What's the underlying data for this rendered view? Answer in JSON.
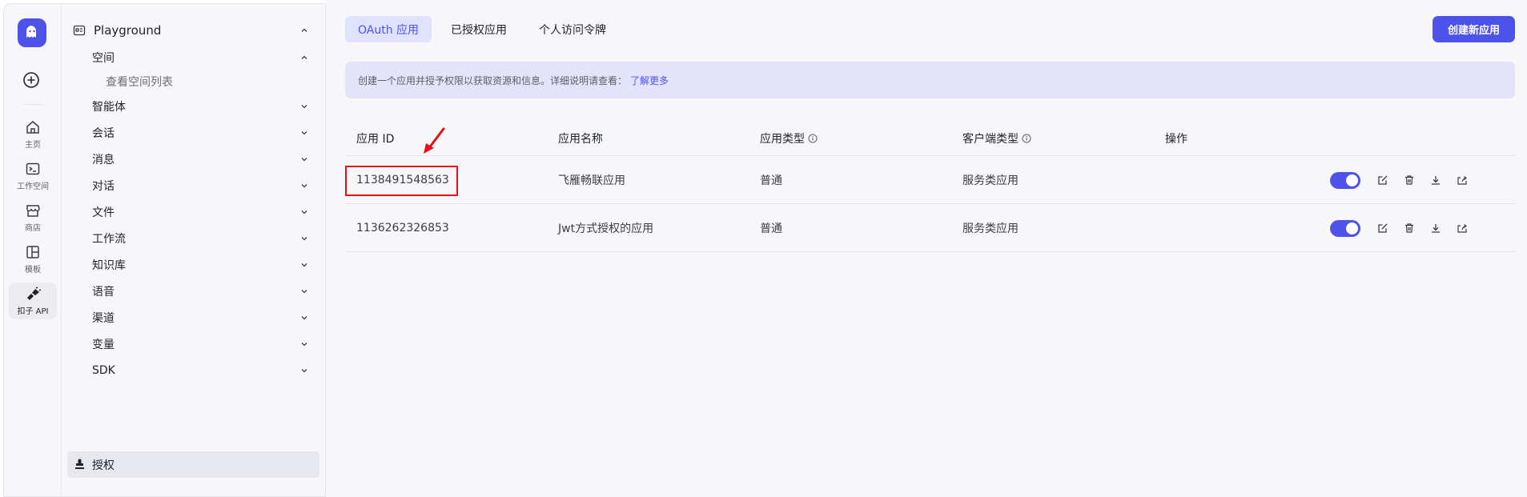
{
  "rail": {
    "items": [
      {
        "label": "主页",
        "icon": "home-icon"
      },
      {
        "label": "工作空间",
        "icon": "terminal-icon"
      },
      {
        "label": "商店",
        "icon": "store-icon"
      },
      {
        "label": "模板",
        "icon": "template-icon"
      },
      {
        "label": "扣子 API",
        "icon": "api-icon"
      }
    ]
  },
  "nav": {
    "playground": "Playground",
    "space": "空间",
    "space_sub": "查看空间列表",
    "items": [
      "智能体",
      "会话",
      "消息",
      "对话",
      "文件",
      "工作流",
      "知识库",
      "语音",
      "渠道",
      "变量",
      "SDK"
    ],
    "active": "授权"
  },
  "tabs": [
    "OAuth 应用",
    "已授权应用",
    "个人访问令牌"
  ],
  "create_button": "创建新应用",
  "banner": {
    "text": "创建一个应用并授予权限以获取资源和信息。详细说明请查看：",
    "link": "了解更多"
  },
  "table": {
    "headers": [
      "应用 ID",
      "应用名称",
      "应用类型",
      "客户端类型",
      "操作"
    ],
    "rows": [
      {
        "id": "1138491548563",
        "name": "飞雁畅联应用",
        "type": "普通",
        "client": "服务类应用",
        "enabled": true
      },
      {
        "id": "1136262326853",
        "name": "Jwt方式授权的应用",
        "type": "普通",
        "client": "服务类应用",
        "enabled": true
      }
    ]
  },
  "colors": {
    "accent": "#4d53e8",
    "highlight": "#e0121b"
  }
}
